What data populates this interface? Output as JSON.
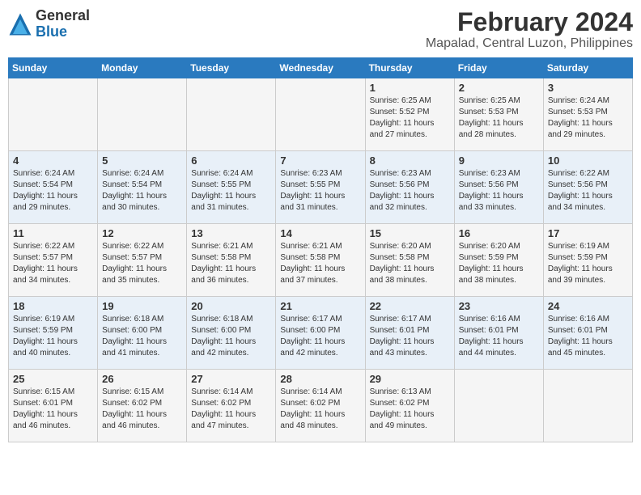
{
  "header": {
    "logo_line1": "General",
    "logo_line2": "Blue",
    "title": "February 2024",
    "subtitle": "Mapalad, Central Luzon, Philippines"
  },
  "days_of_week": [
    "Sunday",
    "Monday",
    "Tuesday",
    "Wednesday",
    "Thursday",
    "Friday",
    "Saturday"
  ],
  "weeks": [
    [
      {
        "num": "",
        "sunrise": "",
        "sunset": "",
        "daylight": ""
      },
      {
        "num": "",
        "sunrise": "",
        "sunset": "",
        "daylight": ""
      },
      {
        "num": "",
        "sunrise": "",
        "sunset": "",
        "daylight": ""
      },
      {
        "num": "",
        "sunrise": "",
        "sunset": "",
        "daylight": ""
      },
      {
        "num": "1",
        "sunrise": "Sunrise: 6:25 AM",
        "sunset": "Sunset: 5:52 PM",
        "daylight": "Daylight: 11 hours and 27 minutes."
      },
      {
        "num": "2",
        "sunrise": "Sunrise: 6:25 AM",
        "sunset": "Sunset: 5:53 PM",
        "daylight": "Daylight: 11 hours and 28 minutes."
      },
      {
        "num": "3",
        "sunrise": "Sunrise: 6:24 AM",
        "sunset": "Sunset: 5:53 PM",
        "daylight": "Daylight: 11 hours and 29 minutes."
      }
    ],
    [
      {
        "num": "4",
        "sunrise": "Sunrise: 6:24 AM",
        "sunset": "Sunset: 5:54 PM",
        "daylight": "Daylight: 11 hours and 29 minutes."
      },
      {
        "num": "5",
        "sunrise": "Sunrise: 6:24 AM",
        "sunset": "Sunset: 5:54 PM",
        "daylight": "Daylight: 11 hours and 30 minutes."
      },
      {
        "num": "6",
        "sunrise": "Sunrise: 6:24 AM",
        "sunset": "Sunset: 5:55 PM",
        "daylight": "Daylight: 11 hours and 31 minutes."
      },
      {
        "num": "7",
        "sunrise": "Sunrise: 6:23 AM",
        "sunset": "Sunset: 5:55 PM",
        "daylight": "Daylight: 11 hours and 31 minutes."
      },
      {
        "num": "8",
        "sunrise": "Sunrise: 6:23 AM",
        "sunset": "Sunset: 5:56 PM",
        "daylight": "Daylight: 11 hours and 32 minutes."
      },
      {
        "num": "9",
        "sunrise": "Sunrise: 6:23 AM",
        "sunset": "Sunset: 5:56 PM",
        "daylight": "Daylight: 11 hours and 33 minutes."
      },
      {
        "num": "10",
        "sunrise": "Sunrise: 6:22 AM",
        "sunset": "Sunset: 5:56 PM",
        "daylight": "Daylight: 11 hours and 34 minutes."
      }
    ],
    [
      {
        "num": "11",
        "sunrise": "Sunrise: 6:22 AM",
        "sunset": "Sunset: 5:57 PM",
        "daylight": "Daylight: 11 hours and 34 minutes."
      },
      {
        "num": "12",
        "sunrise": "Sunrise: 6:22 AM",
        "sunset": "Sunset: 5:57 PM",
        "daylight": "Daylight: 11 hours and 35 minutes."
      },
      {
        "num": "13",
        "sunrise": "Sunrise: 6:21 AM",
        "sunset": "Sunset: 5:58 PM",
        "daylight": "Daylight: 11 hours and 36 minutes."
      },
      {
        "num": "14",
        "sunrise": "Sunrise: 6:21 AM",
        "sunset": "Sunset: 5:58 PM",
        "daylight": "Daylight: 11 hours and 37 minutes."
      },
      {
        "num": "15",
        "sunrise": "Sunrise: 6:20 AM",
        "sunset": "Sunset: 5:58 PM",
        "daylight": "Daylight: 11 hours and 38 minutes."
      },
      {
        "num": "16",
        "sunrise": "Sunrise: 6:20 AM",
        "sunset": "Sunset: 5:59 PM",
        "daylight": "Daylight: 11 hours and 38 minutes."
      },
      {
        "num": "17",
        "sunrise": "Sunrise: 6:19 AM",
        "sunset": "Sunset: 5:59 PM",
        "daylight": "Daylight: 11 hours and 39 minutes."
      }
    ],
    [
      {
        "num": "18",
        "sunrise": "Sunrise: 6:19 AM",
        "sunset": "Sunset: 5:59 PM",
        "daylight": "Daylight: 11 hours and 40 minutes."
      },
      {
        "num": "19",
        "sunrise": "Sunrise: 6:18 AM",
        "sunset": "Sunset: 6:00 PM",
        "daylight": "Daylight: 11 hours and 41 minutes."
      },
      {
        "num": "20",
        "sunrise": "Sunrise: 6:18 AM",
        "sunset": "Sunset: 6:00 PM",
        "daylight": "Daylight: 11 hours and 42 minutes."
      },
      {
        "num": "21",
        "sunrise": "Sunrise: 6:17 AM",
        "sunset": "Sunset: 6:00 PM",
        "daylight": "Daylight: 11 hours and 42 minutes."
      },
      {
        "num": "22",
        "sunrise": "Sunrise: 6:17 AM",
        "sunset": "Sunset: 6:01 PM",
        "daylight": "Daylight: 11 hours and 43 minutes."
      },
      {
        "num": "23",
        "sunrise": "Sunrise: 6:16 AM",
        "sunset": "Sunset: 6:01 PM",
        "daylight": "Daylight: 11 hours and 44 minutes."
      },
      {
        "num": "24",
        "sunrise": "Sunrise: 6:16 AM",
        "sunset": "Sunset: 6:01 PM",
        "daylight": "Daylight: 11 hours and 45 minutes."
      }
    ],
    [
      {
        "num": "25",
        "sunrise": "Sunrise: 6:15 AM",
        "sunset": "Sunset: 6:01 PM",
        "daylight": "Daylight: 11 hours and 46 minutes."
      },
      {
        "num": "26",
        "sunrise": "Sunrise: 6:15 AM",
        "sunset": "Sunset: 6:02 PM",
        "daylight": "Daylight: 11 hours and 46 minutes."
      },
      {
        "num": "27",
        "sunrise": "Sunrise: 6:14 AM",
        "sunset": "Sunset: 6:02 PM",
        "daylight": "Daylight: 11 hours and 47 minutes."
      },
      {
        "num": "28",
        "sunrise": "Sunrise: 6:14 AM",
        "sunset": "Sunset: 6:02 PM",
        "daylight": "Daylight: 11 hours and 48 minutes."
      },
      {
        "num": "29",
        "sunrise": "Sunrise: 6:13 AM",
        "sunset": "Sunset: 6:02 PM",
        "daylight": "Daylight: 11 hours and 49 minutes."
      },
      {
        "num": "",
        "sunrise": "",
        "sunset": "",
        "daylight": ""
      },
      {
        "num": "",
        "sunrise": "",
        "sunset": "",
        "daylight": ""
      }
    ]
  ]
}
